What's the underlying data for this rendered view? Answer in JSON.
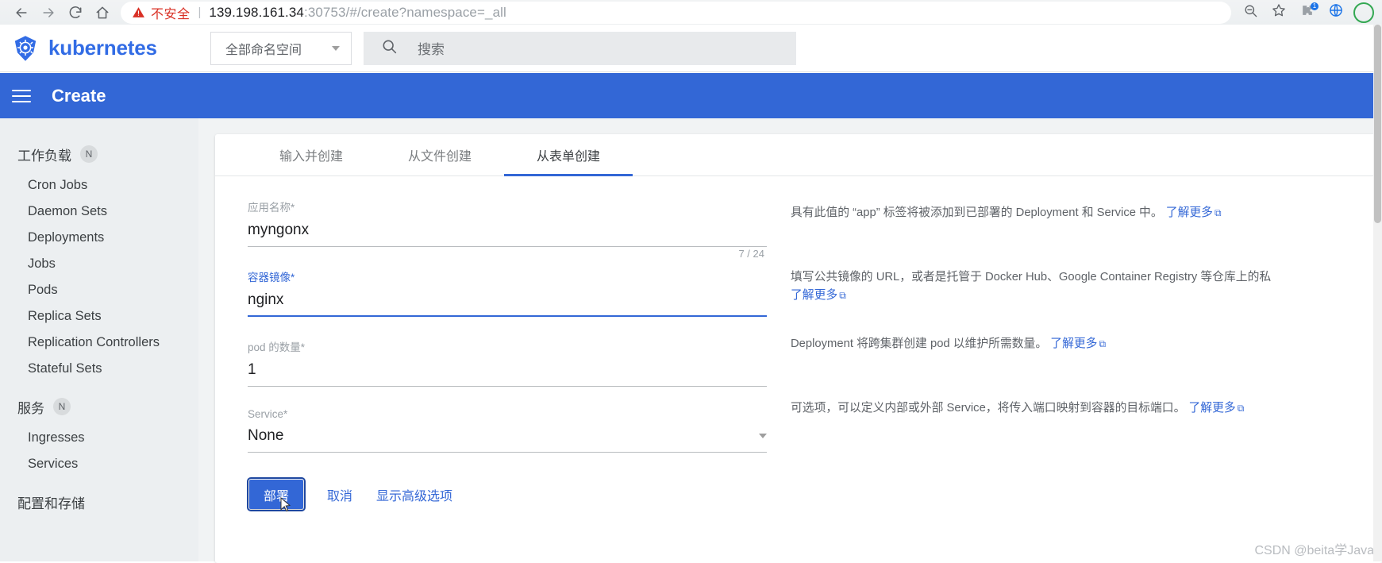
{
  "browser": {
    "back_icon": "arrow-left-icon",
    "forward_icon": "arrow-right-icon",
    "reload_icon": "reload-icon",
    "home_icon": "home-icon",
    "security_warning": "不安全",
    "separator": "|",
    "url_host": "139.198.161.34",
    "url_rest": ":30753/#/create?namespace=_all",
    "zoom_out_icon": "zoom-out-icon",
    "bookmark_icon": "star-icon",
    "extension_badge": "1",
    "extension_icon": "extension-icon",
    "translate_icon": "translate-icon",
    "profile_icon": "avatar-icon"
  },
  "header": {
    "logo_icon": "kubernetes-logo-icon",
    "brand": "kubernetes",
    "namespace_label": "全部命名空间",
    "namespace_caret_icon": "chevron-down-icon",
    "search_icon": "search-icon",
    "search_placeholder": "搜索",
    "search_value": ""
  },
  "action_bar": {
    "menu_icon": "hamburger-menu-icon",
    "title": "Create"
  },
  "sidebar": {
    "groups": [
      {
        "label": "工作负载",
        "badge": "N",
        "items": [
          "Cron Jobs",
          "Daemon Sets",
          "Deployments",
          "Jobs",
          "Pods",
          "Replica Sets",
          "Replication Controllers",
          "Stateful Sets"
        ]
      },
      {
        "label": "服务",
        "badge": "N",
        "items": [
          "Ingresses",
          "Services"
        ]
      },
      {
        "label": "配置和存储",
        "badge": "",
        "items": []
      }
    ]
  },
  "main": {
    "tabs": [
      {
        "label": "输入并创建",
        "active": false
      },
      {
        "label": "从文件创建",
        "active": false
      },
      {
        "label": "从表单创建",
        "active": true
      }
    ],
    "fields": {
      "app_name": {
        "label": "应用名称",
        "required": "*",
        "value": "myngonx",
        "counter": "7 / 24",
        "focused": false
      },
      "container_image": {
        "label": "容器镜像",
        "required": "*",
        "value": "nginx",
        "focused": true
      },
      "pod_count": {
        "label": "pod 的数量",
        "required": "*",
        "value": "1",
        "focused": false
      },
      "service": {
        "label": "Service",
        "required": "*",
        "value": "None",
        "caret_icon": "chevron-down-icon",
        "focused": false
      }
    },
    "buttons": {
      "deploy": "部署",
      "cancel": "取消",
      "advanced": "显示高级选项"
    },
    "help": {
      "app_name": "具有此值的 “app” 标签将被添加到已部署的 Deployment 和 Service 中。",
      "app_name_link": "了解更多",
      "container_image": "填写公共镜像的 URL，或者是托管于 Docker Hub、Google Container Registry 等仓库上的私",
      "container_image_link": "了解更多",
      "pod_count": "Deployment 将跨集群创建 pod 以维护所需数量。",
      "pod_count_link": "了解更多",
      "service": "可选项，可以定义内部或外部 Service，将传入端口映射到容器的目标端口。",
      "service_link": "了解更多",
      "external_icon": "external-link-icon"
    }
  },
  "watermark": "CSDN @beita学Java",
  "colors": {
    "brand_blue": "#326ce5",
    "action_blue": "#3367d6",
    "warning_red": "#d93025"
  }
}
